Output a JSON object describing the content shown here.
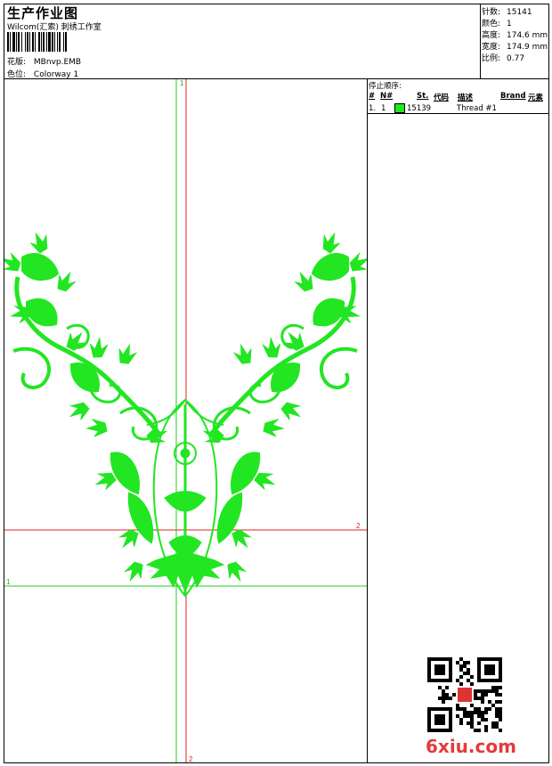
{
  "header": {
    "title": "生产作业图",
    "company": "Wilcom(汇索) 刺绣工作室",
    "design_label": "花版:",
    "design_value": "MBnvp.EMB",
    "colorway_label": "色位:",
    "colorway_value": "Colorway 1"
  },
  "stats": [
    {
      "label": "针数:",
      "value": "15141"
    },
    {
      "label": "颜色:",
      "value": "1"
    },
    {
      "label": "高度:",
      "value": "174.6 mm"
    },
    {
      "label": "宽度:",
      "value": "174.9 mm"
    },
    {
      "label": "比例:",
      "value": "0.77"
    }
  ],
  "stop_sequence": {
    "title": "停止顺序:",
    "headers": {
      "index": "#",
      "needle": "N#",
      "stitches": "St.",
      "code": "代码",
      "desc": "描述",
      "brand": "Brand",
      "element": "元素"
    },
    "rows": [
      {
        "index": "1.",
        "needle": "1",
        "color": "#22e622",
        "code": "15139",
        "desc": "Thread #1"
      }
    ]
  },
  "guides": {
    "v1_label": "1",
    "h1_label": "1",
    "v2_label": "2",
    "h2_label": "2"
  },
  "colors": {
    "thread": "#22e622",
    "guide_green": "#22cc22",
    "guide_red": "#e02020"
  },
  "watermark": "6xiu.com"
}
